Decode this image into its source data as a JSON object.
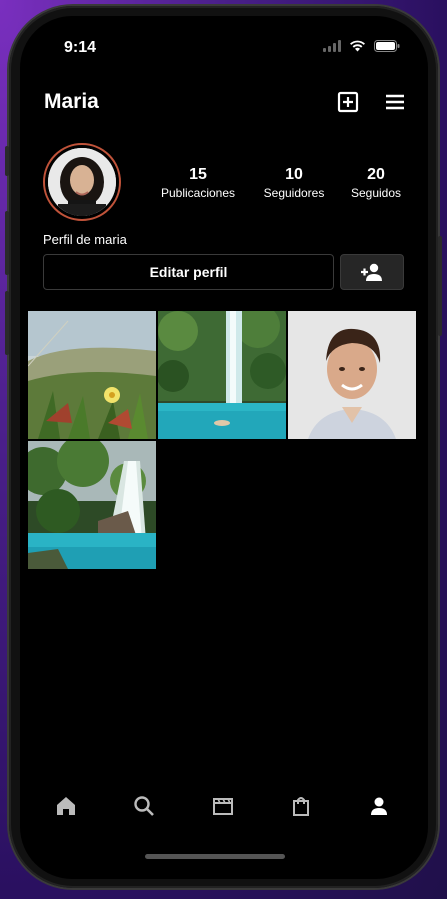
{
  "status_bar": {
    "time": "9:14"
  },
  "header": {
    "username": "Maria"
  },
  "profile": {
    "stats": [
      {
        "value": "15",
        "label": "Publicaciones"
      },
      {
        "value": "10",
        "label": "Seguidores"
      },
      {
        "value": "20",
        "label": "Seguidos"
      }
    ],
    "bio": "Perfil de maria",
    "edit_label": "Editar perfil"
  },
  "colors": {
    "avatar_ring": "#c0533a",
    "background": "#000000",
    "tile_water": "#2bb6c6"
  },
  "icons": [
    "home-icon",
    "search-icon",
    "reels-icon",
    "shop-icon",
    "profile-icon",
    "add-post-icon",
    "menu-icon",
    "add-person-icon"
  ]
}
